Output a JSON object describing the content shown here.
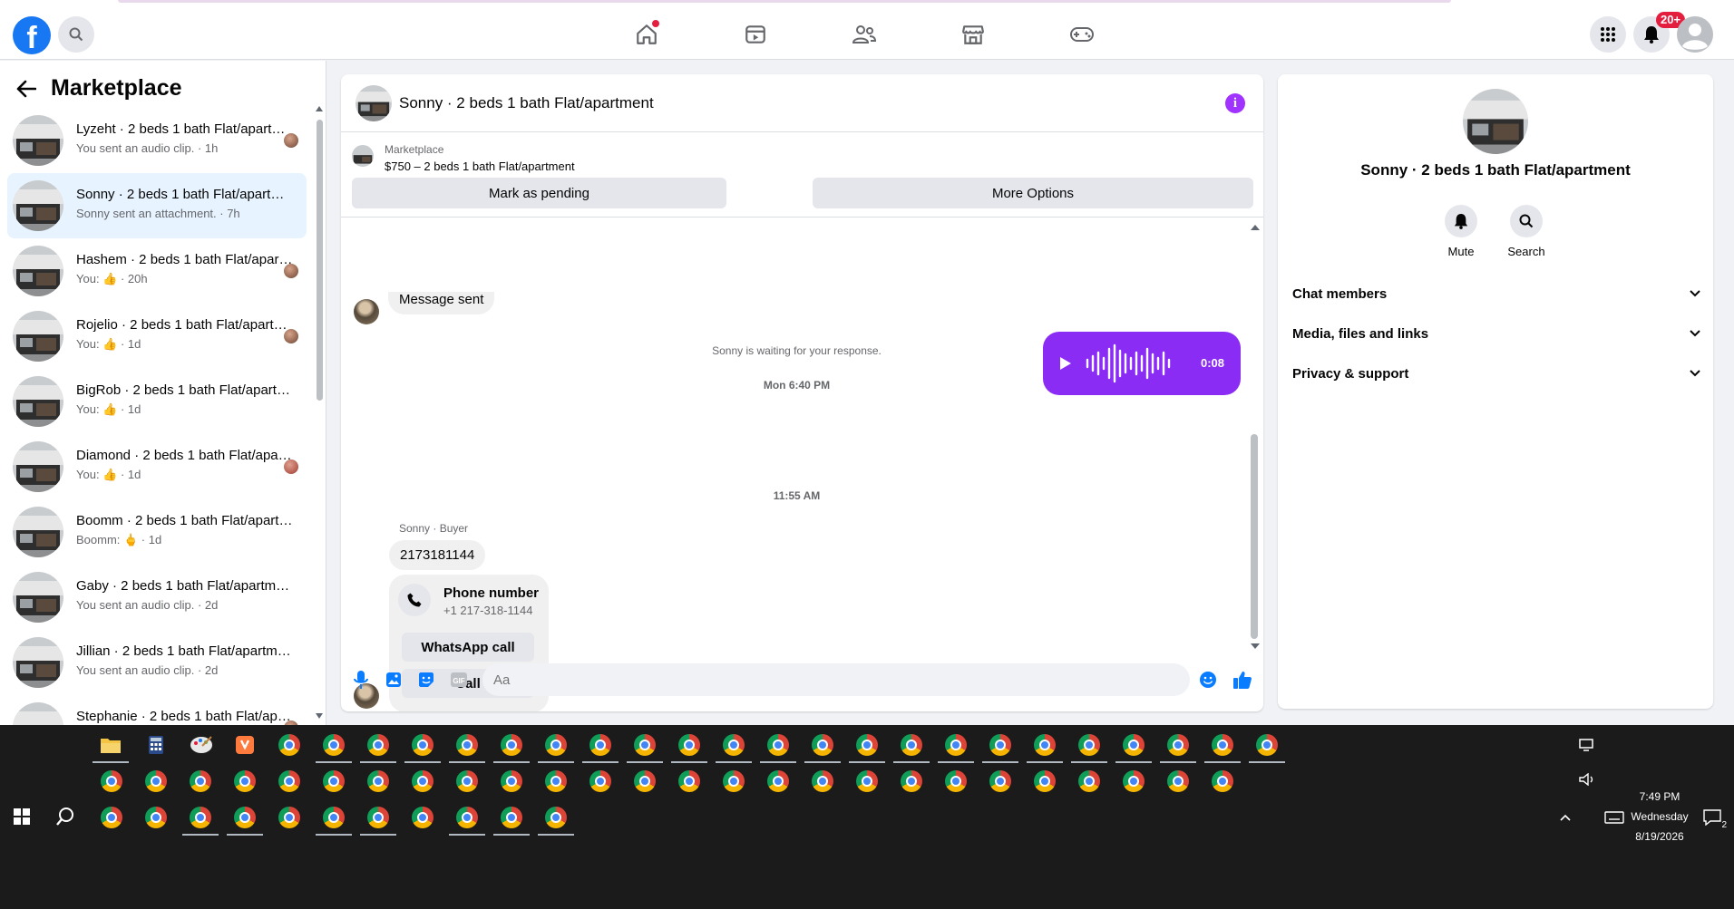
{
  "topnav": {
    "logo": "f",
    "notification_badge": "20+"
  },
  "sidebar": {
    "title": "Marketplace",
    "conversations": [
      {
        "name": "Lyzeht · 2 beds 1 bath Flat/apartment",
        "sub": "You sent an audio clip. · 1h",
        "seen_avatar": true
      },
      {
        "name": "Sonny · 2 beds 1 bath Flat/apartment",
        "sub": "Sonny sent an attachment. · 7h",
        "active": true
      },
      {
        "name": "Hashem · 2 beds 1 bath Flat/apartment",
        "sub": "You: 👍 · 20h",
        "seen_avatar": true
      },
      {
        "name": "Rojelio · 2 beds 1 bath Flat/apartment",
        "sub": "You: 👍 · 1d",
        "seen_avatar": true
      },
      {
        "name": "BigRob · 2 beds 1 bath Flat/apartment",
        "sub": "You: 👍 · 1d"
      },
      {
        "name": "Diamond · 2 beds 1 bath Flat/apartment",
        "sub": "You: 👍 · 1d",
        "seen_avatar": true
      },
      {
        "name": "Boomm · 2 beds 1 bath Flat/apartment",
        "sub": "Boomm: 🖕 · 1d"
      },
      {
        "name": "Gaby · 2 beds 1 bath Flat/apartment",
        "sub": "You sent an audio clip. · 2d"
      },
      {
        "name": "Jillian · 2 beds 1 bath Flat/apartment",
        "sub": "You sent an audio clip. · 2d"
      },
      {
        "name": "Stephanie · 2 beds 1 bath Flat/apartment",
        "sub": ""
      }
    ]
  },
  "chat": {
    "title": "Sonny · 2 beds 1 bath Flat/apartment",
    "listing_source": "Marketplace",
    "listing_title": "$750 – 2 beds 1 bath Flat/apartment",
    "mark_pending_label": "Mark as pending",
    "more_options_label": "More Options",
    "messages": {
      "message_sent": "Message sent",
      "waiting": "Sonny is waiting for your response.",
      "timestamp1": "Mon 6:40 PM",
      "audio_duration": "0:08",
      "timestamp2": "11:55 AM",
      "sender_label": "Sonny · Buyer",
      "phone_text": "2173181144",
      "card_title": "Phone number",
      "card_number": "+1 217-318-1144",
      "whatsapp_label": "WhatsApp call",
      "call_label": "Call"
    },
    "composer_placeholder": "Aa"
  },
  "info_panel": {
    "title": "Sonny · 2 beds 1 bath Flat/apartment",
    "mute_label": "Mute",
    "search_label": "Search",
    "sections": [
      "Chat members",
      "Media, files and links",
      "Privacy & support"
    ]
  },
  "taskbar": {
    "time": "7:49 PM",
    "day": "Wednesday",
    "date": "8/19/2026",
    "notification_count": "2"
  },
  "colors": {
    "facebook_blue": "#1877f2",
    "messenger_purple": "#8b2cf5",
    "active_bg": "#e7f3ff"
  }
}
